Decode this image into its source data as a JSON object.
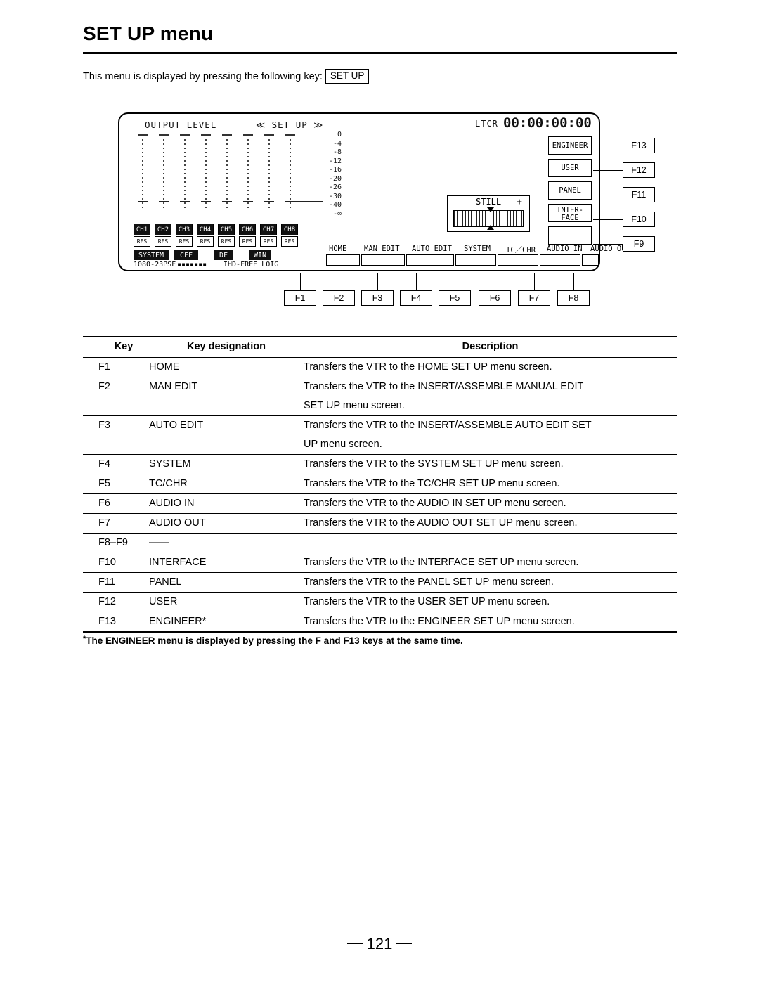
{
  "page": {
    "title": "SET UP menu",
    "intro_text": "This menu is displayed by pressing the following key:",
    "intro_key": "SET UP",
    "page_number": "121"
  },
  "screen": {
    "header_output_level": "OUTPUT LEVEL",
    "header_setup": "≪ SET UP ≫",
    "header_ltcr": "LTCR",
    "timecode": "00:00:00:00",
    "scale_labels": [
      "0",
      "-4",
      "-8",
      "-12",
      "-16",
      "-20",
      "-26",
      "-30",
      "-40",
      "-∞"
    ],
    "channel_boxes": [
      "CH1",
      "CH2",
      "CH3",
      "CH4",
      "CH5",
      "CH6",
      "CH7",
      "CH8"
    ],
    "res_boxes": [
      "RES",
      "RES",
      "RES",
      "RES",
      "RES",
      "RES",
      "RES",
      "RES"
    ],
    "status_blocks": [
      "SYSTEM",
      "CFF",
      "DF",
      "WIN"
    ],
    "status_text_left": "1080-23PSF",
    "status_text_mid": "▪▪▪▪▪▪▪",
    "status_text_right": "IHD-FREE LOIG",
    "still": {
      "label": "STILL",
      "minus": "–",
      "plus": "+"
    },
    "side_keys": [
      {
        "label": "ENGINEER",
        "fkey": "F13"
      },
      {
        "label": "USER",
        "fkey": "F12"
      },
      {
        "label": "PANEL",
        "fkey": "F11"
      },
      {
        "label": "INTER-\nFACE",
        "fkey": "F10"
      },
      {
        "label": "",
        "fkey": "F9"
      }
    ],
    "bottom_keys": [
      {
        "label": "HOME",
        "fkey": "F1"
      },
      {
        "label": "MAN EDIT",
        "fkey": "F2"
      },
      {
        "label": "AUTO EDIT",
        "fkey": "F3"
      },
      {
        "label": "SYSTEM",
        "fkey": "F4"
      },
      {
        "label": "TC／CHR",
        "fkey": "F5"
      },
      {
        "label": "AUDIO IN",
        "fkey": "F6"
      },
      {
        "label": "AUDIO OUT",
        "fkey": "F7"
      },
      {
        "label": "",
        "fkey": "F8"
      }
    ]
  },
  "table": {
    "headers": {
      "key": "Key",
      "designation": "Key designation",
      "description": "Description"
    },
    "rows": [
      {
        "key": "F1",
        "designation": "HOME",
        "description": "Transfers the VTR to the HOME SET UP menu screen.",
        "description2": ""
      },
      {
        "key": "F2",
        "designation": "MAN EDIT",
        "description": "Transfers the VTR to the INSERT/ASSEMBLE MANUAL EDIT",
        "description2": "SET UP menu screen."
      },
      {
        "key": "F3",
        "designation": "AUTO EDIT",
        "description": "Transfers the VTR to the INSERT/ASSEMBLE AUTO EDIT SET",
        "description2": "UP menu screen."
      },
      {
        "key": "F4",
        "designation": "SYSTEM",
        "description": "Transfers the VTR to the SYSTEM SET UP menu screen.",
        "description2": ""
      },
      {
        "key": "F5",
        "designation": "TC/CHR",
        "description": "Transfers the VTR to the TC/CHR SET UP menu screen.",
        "description2": ""
      },
      {
        "key": "F6",
        "designation": "AUDIO IN",
        "description": "Transfers the VTR to the AUDIO IN SET UP menu screen.",
        "description2": ""
      },
      {
        "key": "F7",
        "designation": "AUDIO OUT",
        "description": "Transfers the VTR to the AUDIO OUT SET UP menu screen.",
        "description2": ""
      },
      {
        "key": "F8–F9",
        "designation": "——",
        "description": "",
        "description2": ""
      },
      {
        "key": "F10",
        "designation": "INTERFACE",
        "description": "Transfers the VTR to the INTERFACE SET UP menu screen.",
        "description2": ""
      },
      {
        "key": "F11",
        "designation": "PANEL",
        "description": "Transfers the VTR to the PANEL SET UP menu screen.",
        "description2": ""
      },
      {
        "key": "F12",
        "designation": "USER",
        "description": "Transfers the VTR to the USER SET UP menu screen.",
        "description2": ""
      },
      {
        "key": "F13",
        "designation": "ENGINEER*",
        "description": "Transfers the VTR to the ENGINEER SET UP menu screen.",
        "description2": ""
      }
    ]
  },
  "footnote": {
    "star": "*",
    "text": "The ENGINEER menu is displayed by pressing the F and F13 keys at the same time."
  }
}
